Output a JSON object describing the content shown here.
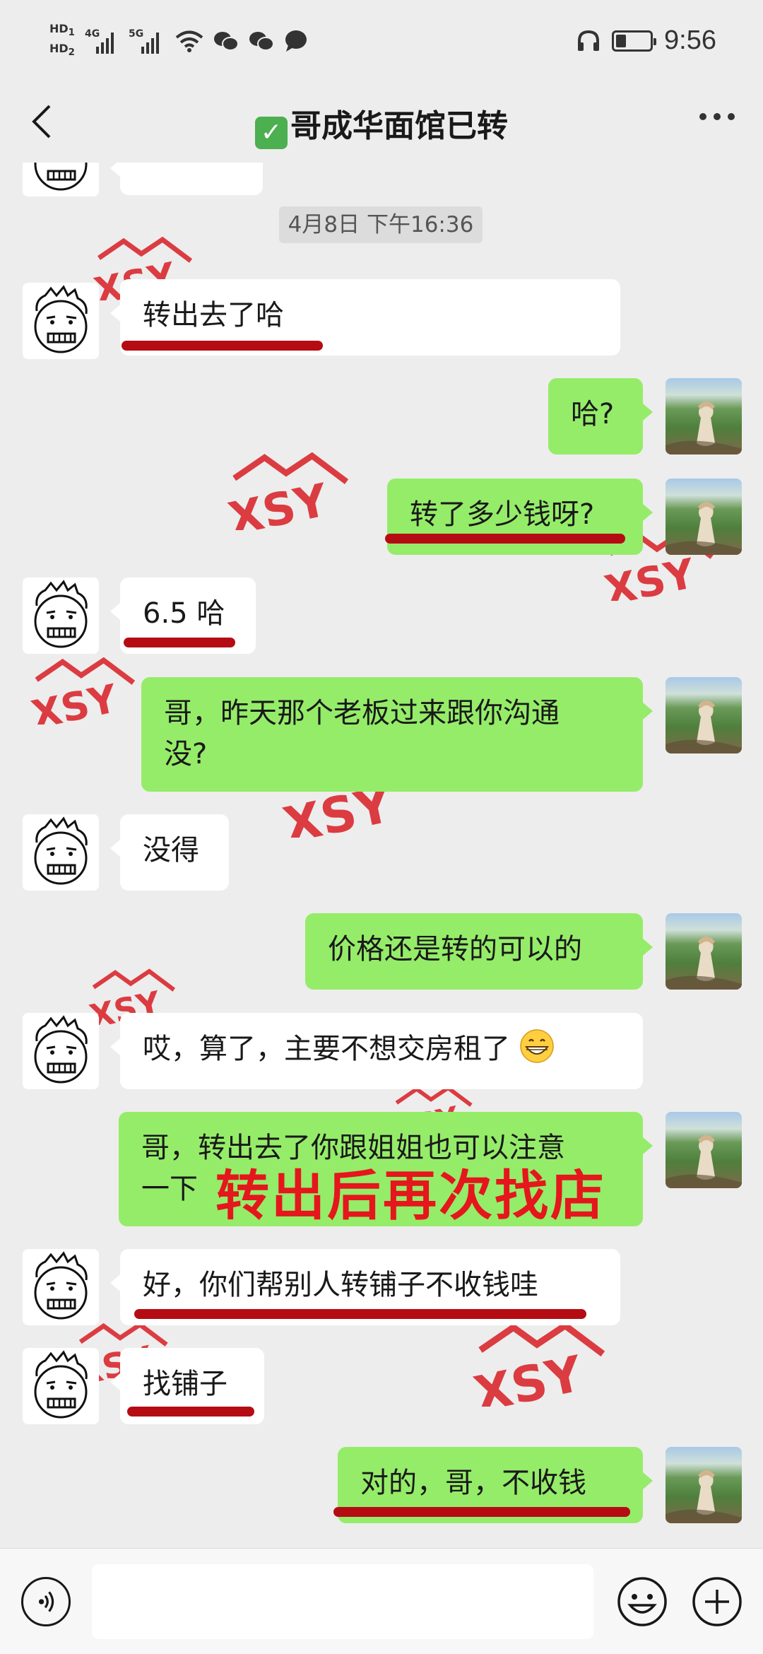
{
  "status_bar": {
    "hd1": "HD",
    "hd1_sub": "1",
    "hd2": "HD",
    "hd2_sub": "2",
    "net1": "4G",
    "net2": "5G",
    "time": "9:56",
    "battery_level": 0.3
  },
  "header": {
    "title": "哥成华面馆已转",
    "check_glyph": "✓"
  },
  "chat": {
    "timestamp": "4月8日 下午16:36",
    "messages": [
      {
        "side": "in",
        "text": "转出去了哈"
      },
      {
        "side": "out",
        "text": "哈?"
      },
      {
        "side": "out",
        "text": "转了多少钱呀?"
      },
      {
        "side": "in",
        "text": "6.5 哈"
      },
      {
        "side": "out",
        "line1": "哥，昨天那个老板过来跟你沟通",
        "line2": "没?"
      },
      {
        "side": "in",
        "text": "没得"
      },
      {
        "side": "out",
        "text": "价格还是转的可以的"
      },
      {
        "side": "in",
        "text": "哎，算了，主要不想交房租了"
      },
      {
        "side": "out",
        "line1": "哥，转出去了你跟姐姐也可以注意",
        "line2": "一下"
      },
      {
        "side": "in",
        "text": "好，你们帮别人转铺子不收钱哇"
      },
      {
        "side": "in",
        "text": "找铺子"
      },
      {
        "side": "out",
        "text": "对的，哥，不收钱"
      }
    ],
    "overlay_caption": "转出后再次找店",
    "watermark": "XSY"
  },
  "colors": {
    "background": "#ededed",
    "bubble_out": "#95ec69",
    "bubble_in": "#ffffff",
    "underline": "#b50c14",
    "caption": "#e5161c"
  },
  "icons": {
    "back": "chevron-left-icon",
    "more": "more-dots-icon",
    "voice": "voice-icon",
    "emoji": "emoji-icon",
    "plus": "plus-icon"
  }
}
